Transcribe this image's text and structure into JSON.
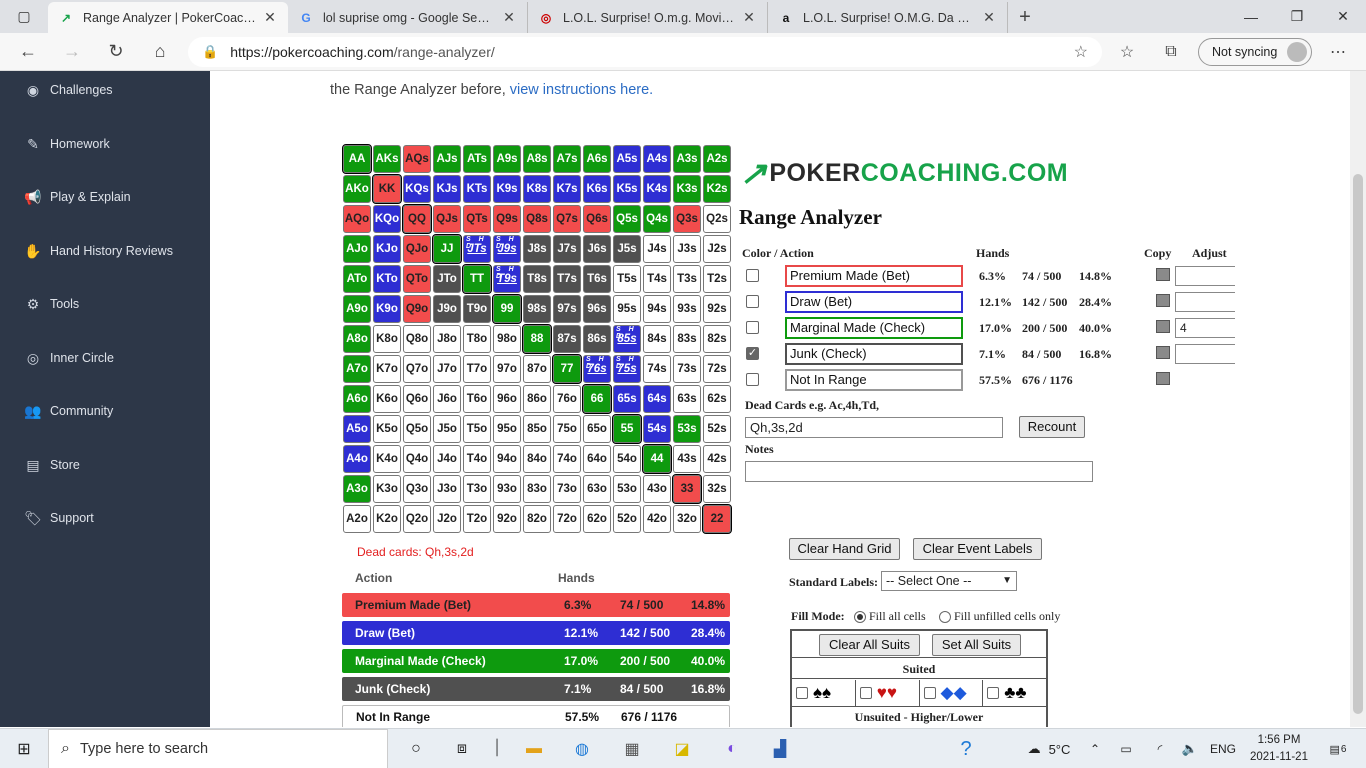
{
  "browser": {
    "tabs": [
      {
        "title": "Range Analyzer | PokerCoaching",
        "icon": "pokercoaching-favicon",
        "active": true
      },
      {
        "title": "lol suprise omg - Google Search",
        "icon": "google-favicon",
        "active": false
      },
      {
        "title": "L.O.L. Surprise! O.m.g. Movie Mag",
        "icon": "target-favicon",
        "active": false
      },
      {
        "title": "L.O.L. Surprise! O.M.G. Da Boss F",
        "icon": "amazon-favicon",
        "active": false
      }
    ],
    "url_host": "https://pokercoaching.com",
    "url_path": "/range-analyzer/",
    "sync_label": "Not syncing"
  },
  "sidebar": {
    "items": [
      {
        "label": "Challenges",
        "icon": "compass-icon"
      },
      {
        "label": "Homework",
        "icon": "edit-icon"
      },
      {
        "label": "Play & Explain",
        "icon": "megaphone-icon"
      },
      {
        "label": "Hand History Reviews",
        "icon": "hand-icon"
      },
      {
        "label": "Tools",
        "icon": "gear-icon"
      },
      {
        "label": "Inner Circle",
        "icon": "target-icon"
      },
      {
        "label": "Community",
        "icon": "users-icon"
      },
      {
        "label": "Store",
        "icon": "store-icon"
      },
      {
        "label": "Support",
        "icon": "tag-icon"
      }
    ]
  },
  "intro": {
    "text": "the Range Analyzer before,",
    "link": "view instructions here."
  },
  "grid": {
    "cells": [
      [
        "AA",
        "AKs",
        "AQs",
        "AJs",
        "ATs",
        "A9s",
        "A8s",
        "A7s",
        "A6s",
        "A5s",
        "A4s",
        "A3s",
        "A2s"
      ],
      [
        "AKo",
        "KK",
        "KQs",
        "KJs",
        "KTs",
        "K9s",
        "K8s",
        "K7s",
        "K6s",
        "K5s",
        "K4s",
        "K3s",
        "K2s"
      ],
      [
        "AQo",
        "KQo",
        "QQ",
        "QJs",
        "QTs",
        "Q9s",
        "Q8s",
        "Q7s",
        "Q6s",
        "Q5s",
        "Q4s",
        "Q3s",
        "Q2s"
      ],
      [
        "AJo",
        "KJo",
        "QJo",
        "JJ",
        "JTs",
        "J9s",
        "J8s",
        "J7s",
        "J6s",
        "J5s",
        "J4s",
        "J3s",
        "J2s"
      ],
      [
        "ATo",
        "KTo",
        "QTo",
        "JTo",
        "TT",
        "T9s",
        "T8s",
        "T7s",
        "T6s",
        "T5s",
        "T4s",
        "T3s",
        "T2s"
      ],
      [
        "A9o",
        "K9o",
        "Q9o",
        "J9o",
        "T9o",
        "99",
        "98s",
        "97s",
        "96s",
        "95s",
        "94s",
        "93s",
        "92s"
      ],
      [
        "A8o",
        "K8o",
        "Q8o",
        "J8o",
        "T8o",
        "98o",
        "88",
        "87s",
        "86s",
        "85s",
        "84s",
        "83s",
        "82s"
      ],
      [
        "A7o",
        "K7o",
        "Q7o",
        "J7o",
        "T7o",
        "97o",
        "87o",
        "77",
        "76s",
        "75s",
        "74s",
        "73s",
        "72s"
      ],
      [
        "A6o",
        "K6o",
        "Q6o",
        "J6o",
        "T6o",
        "96o",
        "86o",
        "76o",
        "66",
        "65s",
        "64s",
        "63s",
        "62s"
      ],
      [
        "A5o",
        "K5o",
        "Q5o",
        "J5o",
        "T5o",
        "95o",
        "85o",
        "75o",
        "65o",
        "55",
        "54s",
        "53s",
        "52s"
      ],
      [
        "A4o",
        "K4o",
        "Q4o",
        "J4o",
        "T4o",
        "94o",
        "84o",
        "74o",
        "64o",
        "54o",
        "44",
        "43s",
        "42s"
      ],
      [
        "A3o",
        "K3o",
        "Q3o",
        "J3o",
        "T3o",
        "93o",
        "83o",
        "73o",
        "63o",
        "53o",
        "43o",
        "33",
        "32s"
      ],
      [
        "A2o",
        "K2o",
        "Q2o",
        "J2o",
        "T2o",
        "92o",
        "82o",
        "72o",
        "62o",
        "52o",
        "42o",
        "32o",
        "22"
      ]
    ],
    "colors": [
      "gggggggggbbgg",
      "grbbbbbbbbbgg",
      "rbrrrrrrrggrw",
      "gbrgppddwwwww",
      "gbrdgpdddwwww",
      "gbrdd gdddwwww",
      "gwwwwwgddpwww",
      "gwwwwwwgppwww",
      "gwwwwwwwgbbww",
      "bwwwwwwwwgbgw",
      "bwwwwwwwwwgww",
      "gwwwwwwwwwwrw",
      "wwwwwwwwwwwwr"
    ],
    "suit_marks": {
      "label": "S H\nD"
    }
  },
  "dead_cards_text": "Dead cards: Qh,3s,2d",
  "summary": {
    "header_action": "Action",
    "header_hands": "Hands",
    "rows": [
      {
        "name": "Premium Made (Bet)",
        "pct": "6.3%",
        "hands": "74 / 500",
        "total": "14.8%",
        "bg": "#f24c4c",
        "fg": "#222"
      },
      {
        "name": "Draw (Bet)",
        "pct": "12.1%",
        "hands": "142 / 500",
        "total": "28.4%",
        "bg": "#2e2ed3",
        "fg": "#ffffff"
      },
      {
        "name": "Marginal Made (Check)",
        "pct": "17.0%",
        "hands": "200 / 500",
        "total": "40.0%",
        "bg": "#0e9a0e",
        "fg": "#ffffff"
      },
      {
        "name": "Junk (Check)",
        "pct": "7.1%",
        "hands": "84 / 500",
        "total": "16.8%",
        "bg": "#505050",
        "fg": "#ffffff"
      },
      {
        "name": "Not In Range",
        "pct": "57.5%",
        "hands": "676 / 1176",
        "total": "",
        "bg": "#ffffff",
        "fg": "#111"
      }
    ]
  },
  "analyzer": {
    "logo_poker": "POKER",
    "logo_coaching": "COACHING.COM",
    "title": "Range Analyzer",
    "col_color_action": "Color / Action",
    "col_hands": "Hands",
    "col_copy": "Copy",
    "col_adjust": "Adjust",
    "actions": [
      {
        "label": "Premium Made (Bet)",
        "pct": "6.3%",
        "hands": "74 / 500",
        "total": "14.8%",
        "border": "#e84848",
        "checked": false,
        "adjust": ""
      },
      {
        "label": "Draw (Bet)",
        "pct": "12.1%",
        "hands": "142 / 500",
        "total": "28.4%",
        "border": "#2e2ed3",
        "checked": false,
        "adjust": ""
      },
      {
        "label": "Marginal Made (Check)",
        "pct": "17.0%",
        "hands": "200 / 500",
        "total": "40.0%",
        "border": "#0e9a0e",
        "checked": false,
        "adjust": "4"
      },
      {
        "label": "Junk (Check)",
        "pct": "7.1%",
        "hands": "84 / 500",
        "total": "16.8%",
        "border": "#505050",
        "checked": true,
        "adjust": ""
      },
      {
        "label": "Not In Range",
        "pct": "57.5%",
        "hands": "676 / 1176",
        "total": "",
        "border": "#999999",
        "checked": false,
        "adjust": null
      }
    ],
    "dead_cards_label": "Dead Cards e.g. Ac,4h,Td,",
    "dead_cards_value": "Qh,3s,2d",
    "recount_label": "Recount",
    "notes_label": "Notes",
    "notes_value": "",
    "clear_grid_label": "Clear Hand Grid",
    "clear_labels_label": "Clear Event Labels",
    "standard_labels_label": "Standard Labels:",
    "standard_labels_value": "-- Select One --",
    "fill_mode_label": "Fill Mode:",
    "fill_all_label": "Fill all cells",
    "fill_unfilled_label": "Fill unfilled cells only",
    "clear_suits_label": "Clear All Suits",
    "set_suits_label": "Set All Suits",
    "suited_label": "Suited",
    "unsuited_label": "Unsuited - Higher/Lower",
    "suits": [
      {
        "glyph": "♠♠",
        "color": "#000000"
      },
      {
        "glyph": "♥♥",
        "color": "#c81414"
      },
      {
        "glyph": "◆◆",
        "color": "#1e5adc"
      },
      {
        "glyph": "♣♣",
        "color": "#000000"
      }
    ]
  },
  "taskbar": {
    "search_placeholder": "Type here to search",
    "weather": "5°C",
    "language": "ENG",
    "time": "1:56 PM",
    "date": "2021-11-21",
    "notification_count": "6"
  }
}
